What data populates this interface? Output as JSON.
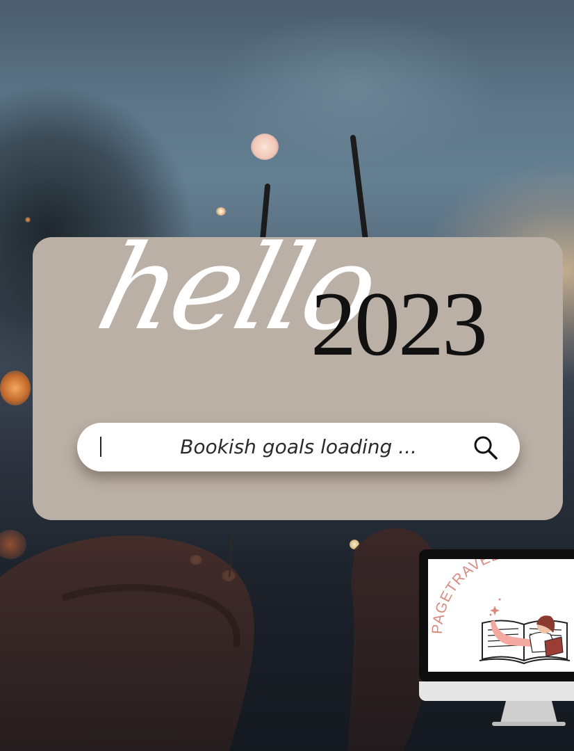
{
  "graphic": {
    "headline_script": "hello",
    "headline_year": "2023",
    "search_bar": {
      "text": "Bookish goals loading ...",
      "icon": "search-icon"
    },
    "logo": {
      "arc_text": "PAGETRAVELWITH",
      "icon": "reading-girl-book-icon"
    }
  },
  "colors": {
    "card": "#bbb0a6",
    "search_bg": "#ffffff",
    "headline_script": "#ffffff",
    "headline_year": "#111111",
    "logo_text": "#d98a80"
  }
}
